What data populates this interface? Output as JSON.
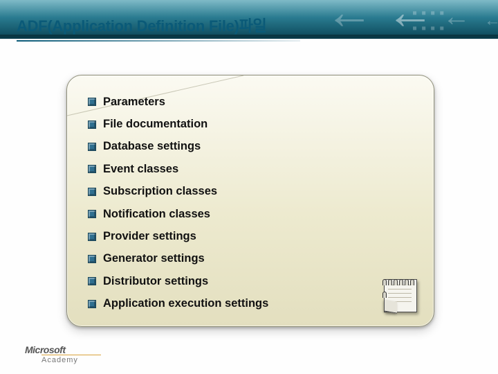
{
  "title": "ADF(Application Definition File)파일",
  "items": [
    "Parameters",
    "File documentation",
    "Database settings",
    "Event classes",
    "Subscription classes",
    "Notification classes",
    "Provider settings",
    "Generator settings",
    "Distributor settings",
    "Application execution settings"
  ],
  "brand": {
    "name": "Microsoft",
    "sub": "Academy"
  }
}
